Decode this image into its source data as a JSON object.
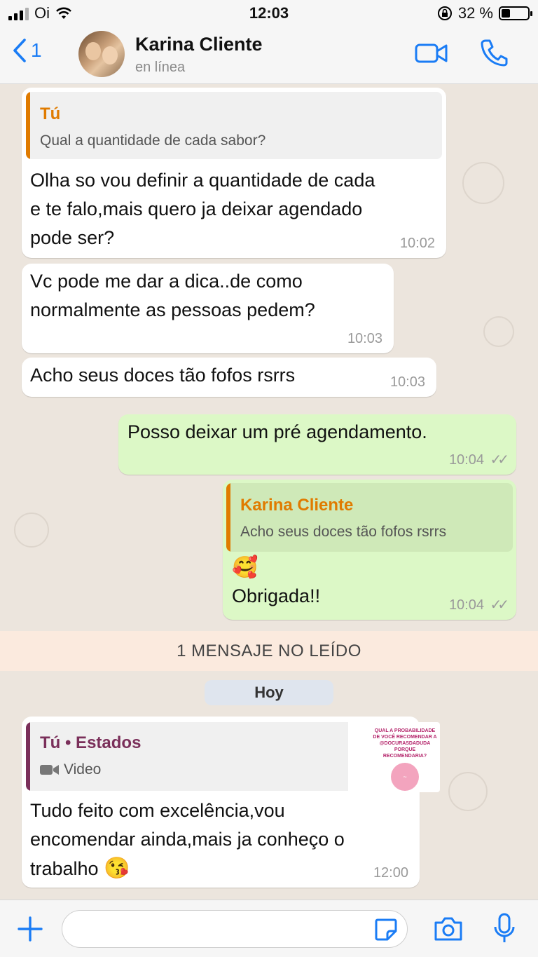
{
  "status_bar": {
    "carrier": "Oi",
    "time": "12:03",
    "battery_percent": "32 %",
    "battery_level": 0.32
  },
  "header": {
    "back_count": "1",
    "contact_name": "Karina Cliente",
    "contact_status": "en línea"
  },
  "messages": [
    {
      "direction": "incoming",
      "quote_author": "Tú",
      "quote_text": "Qual a quantidade de cada sabor?",
      "lines": [
        "Olha so vou definir a quantidade de cada",
        "e te falo,mais quero ja deixar agendado",
        "pode ser?"
      ],
      "time": "10:02"
    },
    {
      "direction": "incoming",
      "lines": [
        "Vc pode me dar a dica..de como",
        "normalmente as pessoas pedem?"
      ],
      "time": "10:03"
    },
    {
      "direction": "incoming",
      "lines": [
        "Acho seus doces tão fofos rsrrs"
      ],
      "time": "10:03"
    },
    {
      "direction": "outgoing",
      "lines": [
        "Posso deixar um  pré agendamento."
      ],
      "time": "10:04",
      "ticks": "✓✓"
    },
    {
      "direction": "outgoing",
      "quote_author": "Karina Cliente",
      "quote_text": "Acho seus doces tão fofos rsrrs",
      "emoji": "🥰",
      "lines": [
        "Obrigada!!"
      ],
      "time": "10:04",
      "ticks": "✓✓"
    },
    {
      "direction": "incoming",
      "quote_author": "Tú • Estados",
      "quote_media": "Video",
      "status_thumb_text": "QUAL A PROBABILIDADE DE VOCÊ RECOMENDAR A @docurasdaduda Porque recomendaria?",
      "lines": [
        "Tudo feito com excelência,vou",
        "encomendar ainda,mais ja conheço o",
        "trabalho"
      ],
      "emoji": "😘",
      "time": "12:00"
    }
  ],
  "unread_banner": "1 MENSAJE NO LEÍDO",
  "date_separator": "Hoy",
  "input": {
    "placeholder": ""
  },
  "colors": {
    "accent_blue": "#1a7cf5",
    "outgoing_bubble": "#dcf8c6",
    "incoming_bubble": "#ffffff",
    "quote_orange": "#e07b00",
    "status_quote_purple": "#7a2f5a"
  },
  "icons": [
    "signal-icon",
    "wifi-icon",
    "lock-rotation-icon",
    "battery-icon",
    "chevron-left-icon",
    "video-call-icon",
    "phone-icon",
    "plus-icon",
    "sticker-icon",
    "camera-icon",
    "microphone-icon",
    "video-camera-icon"
  ]
}
